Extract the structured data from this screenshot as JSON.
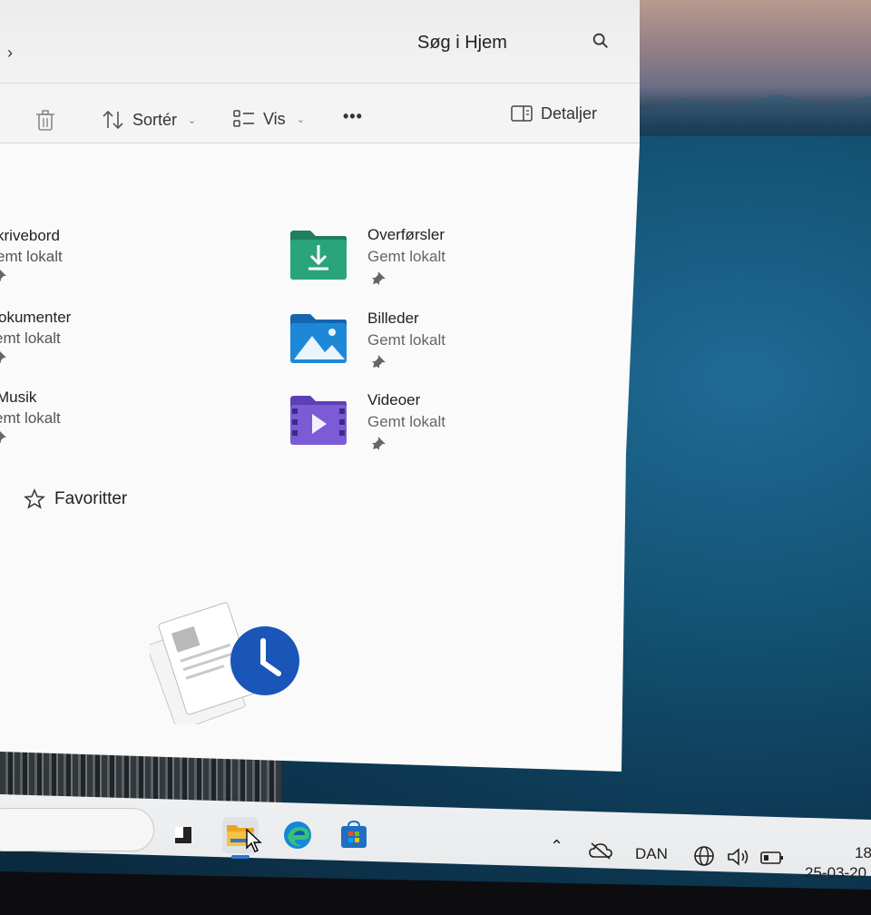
{
  "window": {
    "search_placeholder": "Søg i Hjem"
  },
  "toolbar": {
    "sort_label": "Sortér",
    "view_label": "Vis",
    "more_label": "•••",
    "details_label": "Detaljer"
  },
  "quick_access_left": [
    {
      "name": "krivebord",
      "status": "emt lokalt"
    },
    {
      "name": "okumenter",
      "status": "emt lokalt"
    },
    {
      "name": "Musik",
      "status": "emt lokalt"
    }
  ],
  "quick_access_right": [
    {
      "name": "Overførsler",
      "status": "Gemt lokalt",
      "icon": "download-folder-icon",
      "color": "#2aa47a"
    },
    {
      "name": "Billeder",
      "status": "Gemt lokalt",
      "icon": "pictures-folder-icon",
      "color": "#1e88d8"
    },
    {
      "name": "Videoer",
      "status": "Gemt lokalt",
      "icon": "videos-folder-icon",
      "color": "#7b5bd6"
    }
  ],
  "favorites_label": "Favoritter",
  "taskbar": {
    "language": "DAN",
    "time": "18",
    "date": "25-03-20"
  }
}
